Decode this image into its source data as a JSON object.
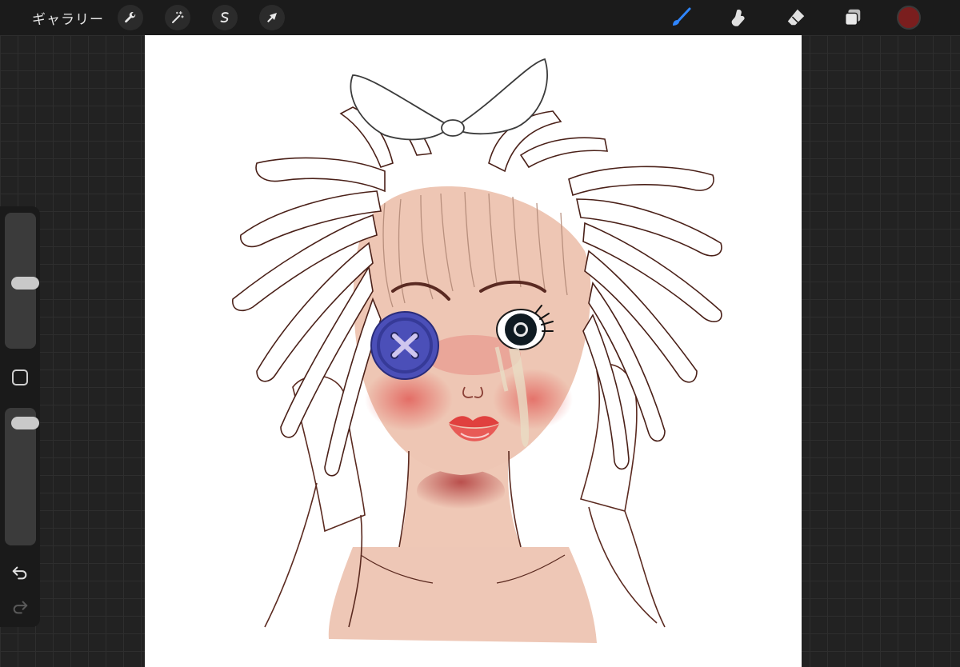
{
  "app": {
    "gallery_label": "ギャラリー"
  },
  "toolbar_left": [
    {
      "icon": "wrench-icon",
      "name": "actions-button"
    },
    {
      "icon": "magic-wand-icon",
      "name": "adjustments-button"
    },
    {
      "icon": "selection-s-icon",
      "name": "selection-button"
    },
    {
      "icon": "arrow-cursor-icon",
      "name": "transform-button"
    }
  ],
  "toolbar_right": [
    {
      "icon": "brush-icon",
      "name": "brush-tool",
      "active": true
    },
    {
      "icon": "smudge-icon",
      "name": "smudge-tool",
      "active": false
    },
    {
      "icon": "eraser-icon",
      "name": "eraser-tool",
      "active": false
    },
    {
      "icon": "layers-icon",
      "name": "layers-button",
      "active": false
    }
  ],
  "colors": {
    "active_color": "#7a1e1e",
    "accent_blue": "#2f86ff",
    "canvas_bg": "#ffffff"
  },
  "sidebar": {
    "brush_size_level": 0.48,
    "opacity_level": 0.06
  },
  "canvas": {
    "artwork": "crying-girl-with-button-eye-illustration"
  }
}
